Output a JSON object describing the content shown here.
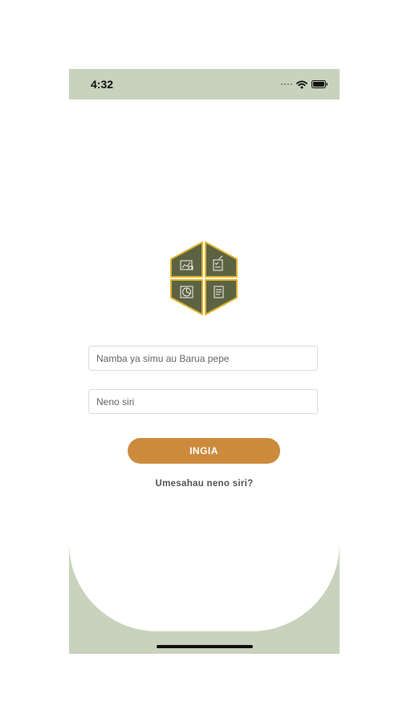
{
  "status_bar": {
    "time": "4:32",
    "icons": [
      "cellular-signal-icon",
      "wifi-icon",
      "battery-icon"
    ]
  },
  "logo": {
    "icons": [
      "chart-board-icon",
      "checklist-icon",
      "pie-chart-icon",
      "document-icon"
    ],
    "colors": {
      "fill": "#5c6343",
      "border": "#e0b32c"
    }
  },
  "login_form": {
    "username_placeholder": "Namba ya simu au Barua pepe",
    "username_value": "",
    "password_placeholder": "Neno siri",
    "password_value": "",
    "submit_label": "INGIA",
    "forgot_password_label": "Umesahau neno siri?"
  },
  "colors": {
    "background_frame": "#c8d2bc",
    "accent": "#cc8a3c"
  }
}
